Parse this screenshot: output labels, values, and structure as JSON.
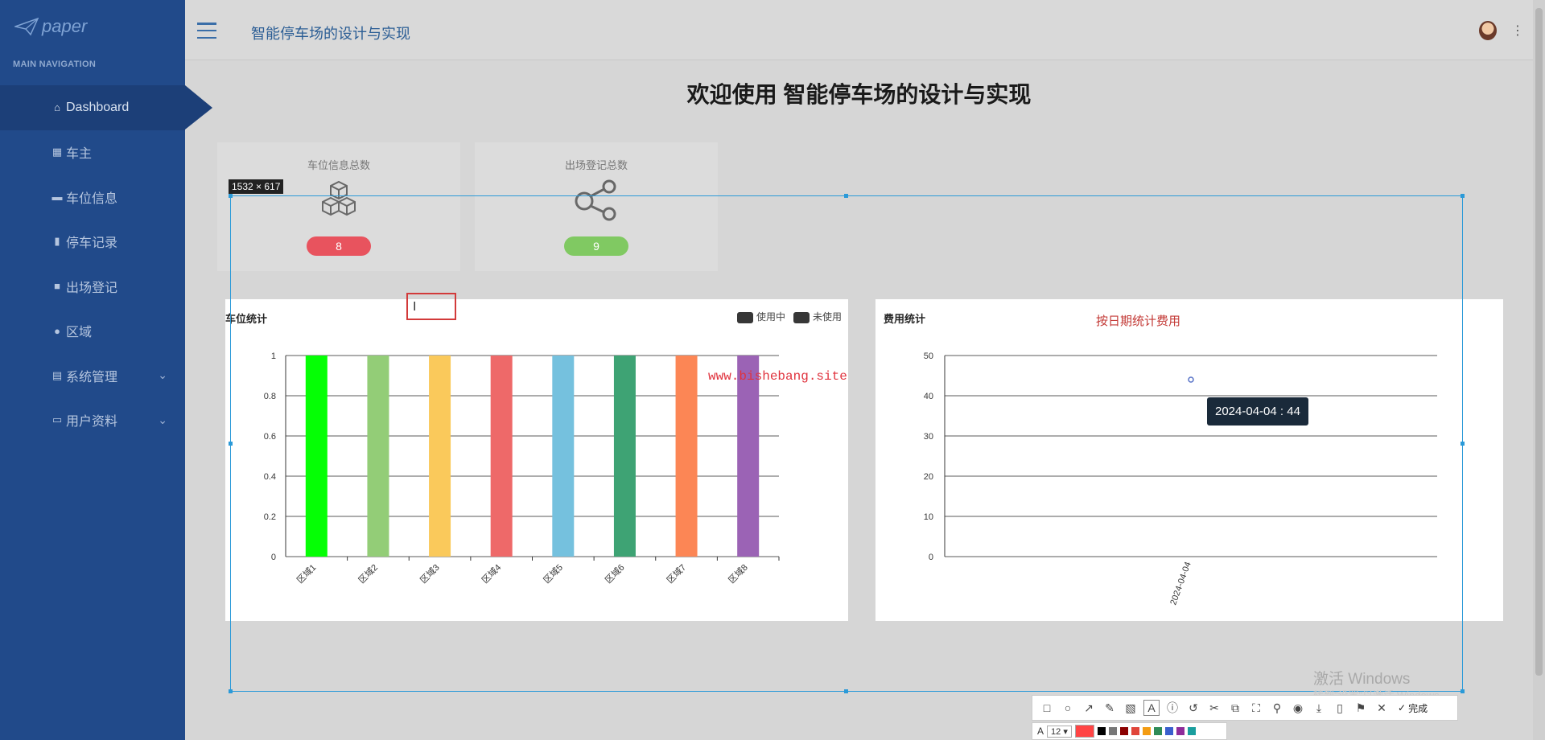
{
  "app": {
    "logo_text": "paper",
    "title": "智能停车场的设计与实现"
  },
  "sidebar": {
    "header": "MAIN NAVIGATION",
    "items": [
      {
        "label": "Dashboard",
        "icon": "home-icon",
        "active": true
      },
      {
        "label": "车主",
        "icon": "grid-icon"
      },
      {
        "label": "车位信息",
        "icon": "briefcase-icon"
      },
      {
        "label": "停车记录",
        "icon": "bar-chart-icon"
      },
      {
        "label": "出场登记",
        "icon": "comment-icon"
      },
      {
        "label": "区域",
        "icon": "user-icon"
      },
      {
        "label": "系统管理",
        "icon": "table-icon",
        "expandable": true
      },
      {
        "label": "用户资料",
        "icon": "card-icon",
        "expandable": true
      }
    ]
  },
  "page": {
    "heading": "欢迎使用 智能停车场的设计与实现"
  },
  "stats": [
    {
      "label": "车位信息总数",
      "value": "8",
      "color": "#e8505b",
      "icon": "cubes-icon"
    },
    {
      "label": "出场登记总数",
      "value": "9",
      "color": "#7ec85f",
      "icon": "share-icon"
    }
  ],
  "parking_panel": {
    "title": "车位统计",
    "legend": [
      "使用中",
      "未使用"
    ]
  },
  "fee_panel": {
    "title": "费用统计",
    "subtitle": "按日期统计费用"
  },
  "chart_data": [
    {
      "type": "bar",
      "title": "车位统计",
      "categories": [
        "区域1",
        "区域2",
        "区域3",
        "区域4",
        "区域5",
        "区域6",
        "区域7",
        "区域8"
      ],
      "series": [
        {
          "name": "使用中",
          "values": [
            1,
            1,
            1,
            1,
            1,
            1,
            1,
            1
          ]
        }
      ],
      "colors": [
        "#00ff00",
        "#91cc75",
        "#fac858",
        "#ee6666",
        "#73c0de",
        "#3ba272",
        "#fc8452",
        "#9a60b4"
      ],
      "ylim": [
        0,
        1
      ],
      "yticks": [
        "0",
        "0.2",
        "0.4",
        "0.6",
        "0.8",
        "1"
      ],
      "legend_position": "top-right",
      "grid": true
    },
    {
      "type": "line",
      "title": "按日期统计费用",
      "x": [
        "2024-04-04"
      ],
      "series": [
        {
          "values": [
            44
          ]
        }
      ],
      "ylim": [
        0,
        50
      ],
      "yticks": [
        "0",
        "10",
        "20",
        "30",
        "40",
        "50"
      ],
      "grid": true
    }
  ],
  "overlay": {
    "size_tag": "1532 × 617",
    "watermark_url": "www.bishebang.site",
    "tooltip": "2024-04-04 : 44",
    "windows_activate": "激活 Windows",
    "windows_activate_hint": "转到\"设置\"以激活 Windows。",
    "toolbar_done": "完成",
    "font_size": "12"
  }
}
